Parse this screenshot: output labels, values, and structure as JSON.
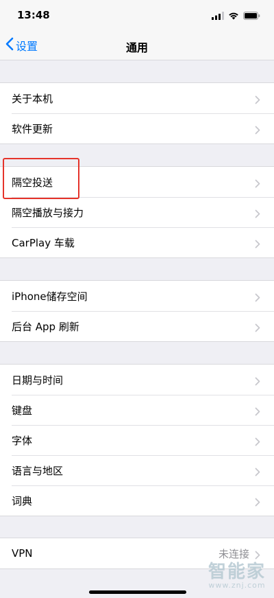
{
  "status_bar": {
    "time": "13:48",
    "icons": [
      "signal-icon",
      "wifi-icon",
      "battery-icon"
    ]
  },
  "nav": {
    "back_label": "设置",
    "title": "通用"
  },
  "groups": [
    {
      "items": [
        {
          "label": "关于本机"
        },
        {
          "label": "软件更新"
        }
      ]
    },
    {
      "items": [
        {
          "label": "隔空投送"
        },
        {
          "label": "隔空播放与接力"
        },
        {
          "label": "CarPlay 车载"
        }
      ]
    },
    {
      "items": [
        {
          "label": "iPhone储存空间"
        },
        {
          "label": "后台 App 刷新"
        }
      ]
    },
    {
      "items": [
        {
          "label": "日期与时间"
        },
        {
          "label": "键盘"
        },
        {
          "label": "字体"
        },
        {
          "label": "语言与地区"
        },
        {
          "label": "词典"
        }
      ]
    },
    {
      "items": [
        {
          "label": "VPN",
          "value": "未连接"
        }
      ]
    }
  ],
  "annotation": {
    "highlighted_item": "隔空投送",
    "color": "#e5332a"
  },
  "watermark": {
    "logo_text": "智能家",
    "url": "www.znj.com"
  },
  "colors": {
    "accent": "#007aff",
    "background": "#efeff4",
    "chevron": "#c7c7cc",
    "secondary_text": "#8e8e93"
  }
}
